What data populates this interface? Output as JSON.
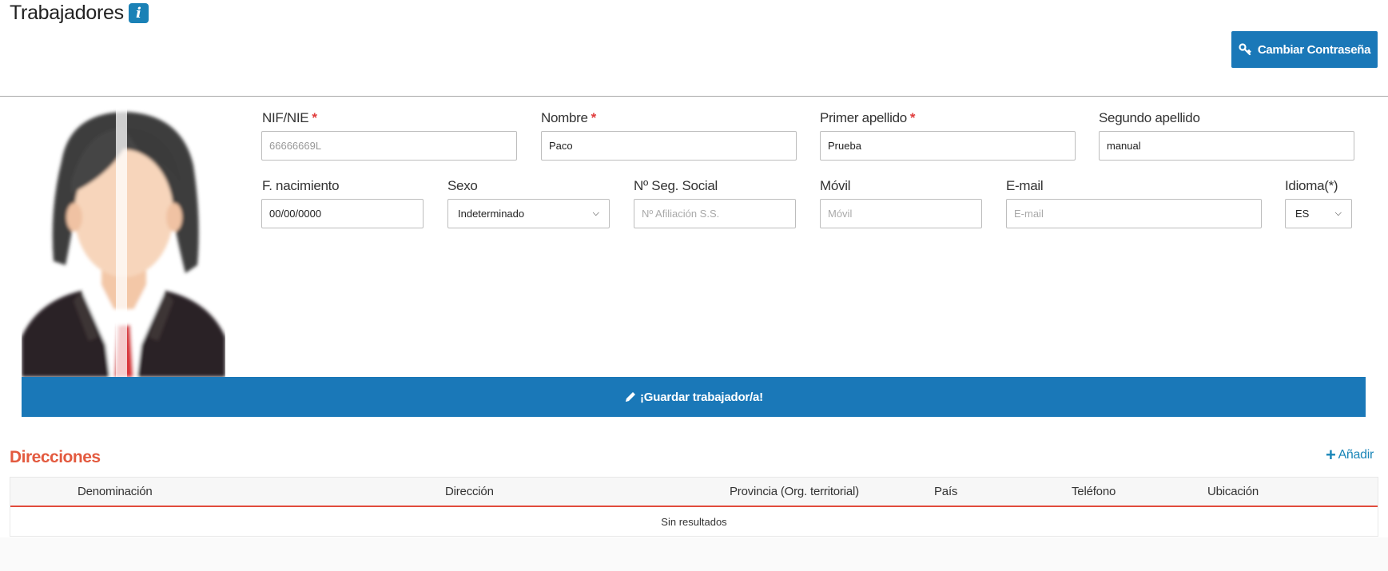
{
  "header": {
    "title": "Trabajadores",
    "info_icon": "i",
    "change_password_label": "Cambiar Contraseña"
  },
  "form": {
    "nif": {
      "label": "NIF/NIE",
      "required_mark": "*",
      "value": "66666669L"
    },
    "nombre": {
      "label": "Nombre",
      "required_mark": "*",
      "value": "Paco"
    },
    "primer_apellido": {
      "label": "Primer apellido",
      "required_mark": "*",
      "value": "Prueba"
    },
    "segundo_apellido": {
      "label": "Segundo apellido",
      "value": "manual"
    },
    "f_nacimiento": {
      "label": "F. nacimiento",
      "value": "00/00/0000"
    },
    "sexo": {
      "label": "Sexo",
      "value": "Indeterminado"
    },
    "seg_social": {
      "label": "Nº Seg. Social",
      "placeholder": "Nº Afiliación S.S."
    },
    "movil": {
      "label": "Móvil",
      "placeholder": "Móvil"
    },
    "email": {
      "label": "E-mail",
      "placeholder": "E-mail"
    },
    "idioma": {
      "label": "Idioma(*)",
      "value": "ES"
    }
  },
  "save_button_label": "¡Guardar trabajador/a!",
  "direcciones": {
    "title": "Direcciones",
    "add_label": "Añadir",
    "columns": [
      "Denominación",
      "Dirección",
      "Provincia (Org. territorial)",
      "País",
      "Teléfono",
      "Ubicación"
    ],
    "empty_text": "Sin resultados"
  },
  "colors": {
    "primary": "#1a78b8",
    "accent_red": "#e35a3f",
    "required": "#e03c3c"
  },
  "icons": {
    "info": "info-icon",
    "key": "key-icon",
    "pencil": "pencil-icon",
    "plus": "plus-icon",
    "chevron": "chevron-down-icon"
  }
}
